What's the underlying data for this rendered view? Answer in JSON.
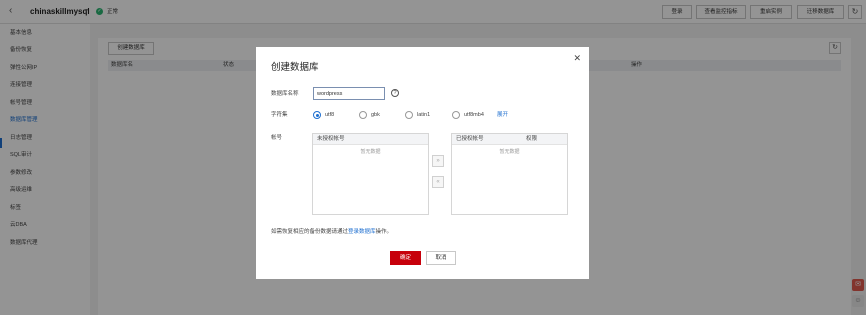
{
  "header": {
    "instance_name": "chinaskillmysql",
    "status": "正常",
    "buttons": [
      "登录",
      "查看监控指标",
      "重启实例",
      "迁移数据库"
    ],
    "back_icon": "back-arrow-icon",
    "refresh_icon": "refresh-icon"
  },
  "sidebar": {
    "items": [
      {
        "label": "基本信息"
      },
      {
        "label": "备份恢复"
      },
      {
        "label": "弹性公网IP"
      },
      {
        "label": "连接管理"
      },
      {
        "label": "帐号管理"
      },
      {
        "label": "数据库管理",
        "active": true
      },
      {
        "label": "日志管理"
      },
      {
        "label": "SQL审计"
      },
      {
        "label": "参数修改"
      },
      {
        "label": "高级运维"
      },
      {
        "label": "标签"
      },
      {
        "label": "云DBA"
      },
      {
        "label": "数据库代理"
      }
    ]
  },
  "main": {
    "create_button": "创建数据库",
    "columns": [
      "数据库名",
      "状态",
      "操作"
    ]
  },
  "dialog": {
    "title": "创建数据库",
    "name_label": "数据库名称",
    "name_value": "wordpress",
    "charset_label": "字符集",
    "charsets": [
      {
        "label": "utf8",
        "selected": true
      },
      {
        "label": "gbk",
        "selected": false
      },
      {
        "label": "latin1",
        "selected": false
      },
      {
        "label": "utf8mb4",
        "selected": false
      }
    ],
    "expand_link": "展开",
    "account_label": "帐号",
    "unauthorized_header": "未授权帐号",
    "authorized_header": "已授权帐号",
    "permission_header": "权限",
    "empty_text": "暂无数据",
    "note_prefix": "如需恢复相应的备份数据请通过",
    "note_link": "登录数据库",
    "note_suffix": "操作。",
    "ok_button": "确定",
    "cancel_button": "取消"
  },
  "colors": {
    "primary_red": "#c7000b",
    "link_blue": "#1e6fd0",
    "status_green": "#2bb673"
  }
}
